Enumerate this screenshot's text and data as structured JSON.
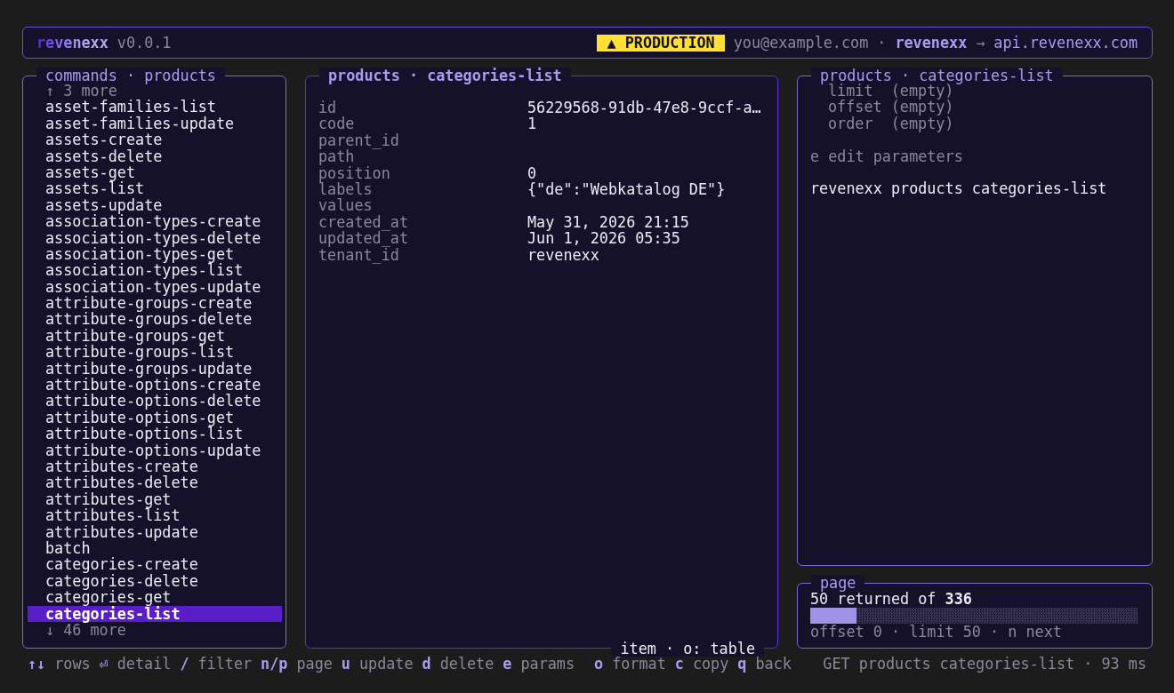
{
  "header": {
    "app_name": "revenexx",
    "version": "v0.0.1",
    "environment_badge": "▲ PRODUCTION",
    "user": "you@example.com",
    "separator": "·",
    "tenant": "revenexx",
    "arrow": "→",
    "api_host": "api.revenexx.com"
  },
  "commands_panel": {
    "title": "commands · products",
    "focused": false,
    "more_above": "↑ 3 more",
    "items": [
      {
        "label": "asset-families-list",
        "selected": false
      },
      {
        "label": "asset-families-update",
        "selected": false
      },
      {
        "label": "assets-create",
        "selected": false
      },
      {
        "label": "assets-delete",
        "selected": false
      },
      {
        "label": "assets-get",
        "selected": false
      },
      {
        "label": "assets-list",
        "selected": false
      },
      {
        "label": "assets-update",
        "selected": false
      },
      {
        "label": "association-types-create",
        "selected": false
      },
      {
        "label": "association-types-delete",
        "selected": false
      },
      {
        "label": "association-types-get",
        "selected": false
      },
      {
        "label": "association-types-list",
        "selected": false
      },
      {
        "label": "association-types-update",
        "selected": false
      },
      {
        "label": "attribute-groups-create",
        "selected": false
      },
      {
        "label": "attribute-groups-delete",
        "selected": false
      },
      {
        "label": "attribute-groups-get",
        "selected": false
      },
      {
        "label": "attribute-groups-list",
        "selected": false
      },
      {
        "label": "attribute-groups-update",
        "selected": false
      },
      {
        "label": "attribute-options-create",
        "selected": false
      },
      {
        "label": "attribute-options-delete",
        "selected": false
      },
      {
        "label": "attribute-options-get",
        "selected": false
      },
      {
        "label": "attribute-options-list",
        "selected": false
      },
      {
        "label": "attribute-options-update",
        "selected": false
      },
      {
        "label": "attributes-create",
        "selected": false
      },
      {
        "label": "attributes-delete",
        "selected": false
      },
      {
        "label": "attributes-get",
        "selected": false
      },
      {
        "label": "attributes-list",
        "selected": false
      },
      {
        "label": "attributes-update",
        "selected": false
      },
      {
        "label": "batch",
        "selected": false
      },
      {
        "label": "categories-create",
        "selected": false
      },
      {
        "label": "categories-delete",
        "selected": false
      },
      {
        "label": "categories-get",
        "selected": false
      },
      {
        "label": "categories-list",
        "selected": true
      }
    ],
    "more_below": "↓ 46 more"
  },
  "detail_panel": {
    "title": "products · categories-list",
    "focused": true,
    "fields": [
      {
        "key": "id",
        "value": "56229568-91db-47e8-9ccf-a…"
      },
      {
        "key": "code",
        "value": "1"
      },
      {
        "key": "parent_id"
      },
      {
        "key": "path"
      },
      {
        "key": "position",
        "value": "0"
      },
      {
        "key": "labels",
        "value": "{\"de\":\"Webkatalog DE\"}"
      },
      {
        "key": "values"
      },
      {
        "key": "created_at",
        "value": "May 31, 2026 21:15"
      },
      {
        "key": "updated_at",
        "value": "Jun 1, 2026 05:35"
      },
      {
        "key": "tenant_id",
        "value": "revenexx"
      }
    ],
    "footer": "item · o: table"
  },
  "params_panel": {
    "title": "products · categories-list",
    "focused": false,
    "params": [
      {
        "name": "limit",
        "value": "(empty)"
      },
      {
        "name": "offset",
        "value": "(empty)"
      },
      {
        "name": "order",
        "value": "(empty)"
      }
    ],
    "hint": "e edit parameters",
    "command": "revenexx products categories-list"
  },
  "page_panel": {
    "title": "page",
    "focused": false,
    "summary": "50 returned of **336**",
    "level": 0.14,
    "footer": "offset 0 · limit 50 · n next"
  },
  "status_bar": {
    "row_hints": [
      {
        "key": "↑↓",
        "label": "rows"
      },
      {
        "key": "⏎",
        "label": "detail"
      },
      {
        "key": "/",
        "label": "filter"
      },
      {
        "key": "n/p",
        "label": "page"
      },
      {
        "key": "u",
        "label": "update"
      },
      {
        "key": "d",
        "label": "delete"
      },
      {
        "key": "e",
        "label": "params"
      }
    ],
    "view_hints": [
      {
        "key": "o",
        "label": "format"
      },
      {
        "key": "c",
        "label": "copy"
      },
      {
        "key": "q",
        "label": "back"
      }
    ],
    "request": "GET products categories-list · 93 ms"
  }
}
